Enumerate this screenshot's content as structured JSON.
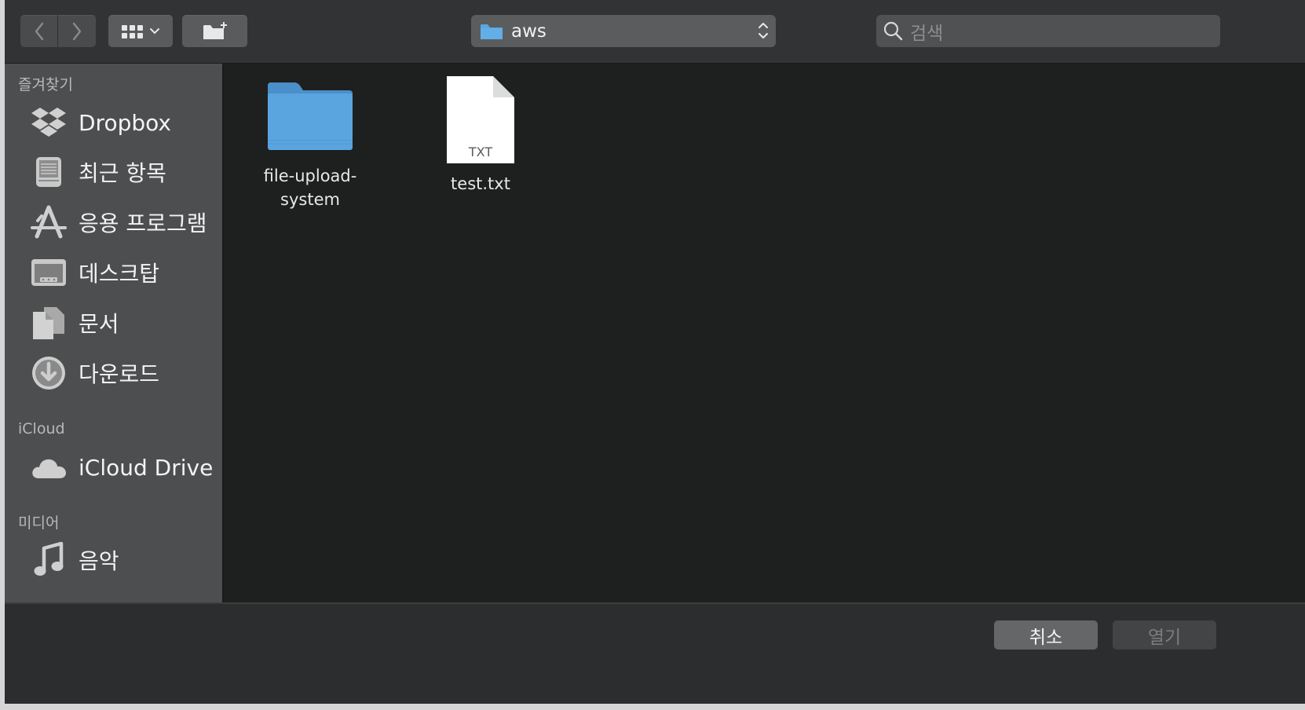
{
  "toolbar": {
    "path": "aws",
    "search_placeholder": "검색"
  },
  "sidebar": {
    "favorites_header": "즐겨찾기",
    "favorites": [
      {
        "label": "Dropbox",
        "icon": "dropbox-icon"
      },
      {
        "label": "최근 항목",
        "icon": "recents-icon"
      },
      {
        "label": "응용 프로그램",
        "icon": "applications-icon"
      },
      {
        "label": "데스크탑",
        "icon": "desktop-icon"
      },
      {
        "label": "문서",
        "icon": "documents-icon"
      },
      {
        "label": "다운로드",
        "icon": "downloads-icon"
      }
    ],
    "icloud_header": "iCloud",
    "icloud": [
      {
        "label": "iCloud Drive",
        "icon": "cloud-icon"
      }
    ],
    "media_header": "미디어",
    "media": [
      {
        "label": "음악",
        "icon": "music-note-icon"
      }
    ]
  },
  "files": [
    {
      "name_line1": "file-upload-",
      "name_line2": "system",
      "kind": "folder"
    },
    {
      "name_line1": "test.txt",
      "kind": "text",
      "badge": "TXT"
    }
  ],
  "footer": {
    "cancel_label": "취소",
    "open_label": "열기"
  },
  "colors": {
    "folder_blue": "#5aa5df",
    "window_bg": "#1e1f1f",
    "sidebar_bg": "#4d4e4f"
  }
}
